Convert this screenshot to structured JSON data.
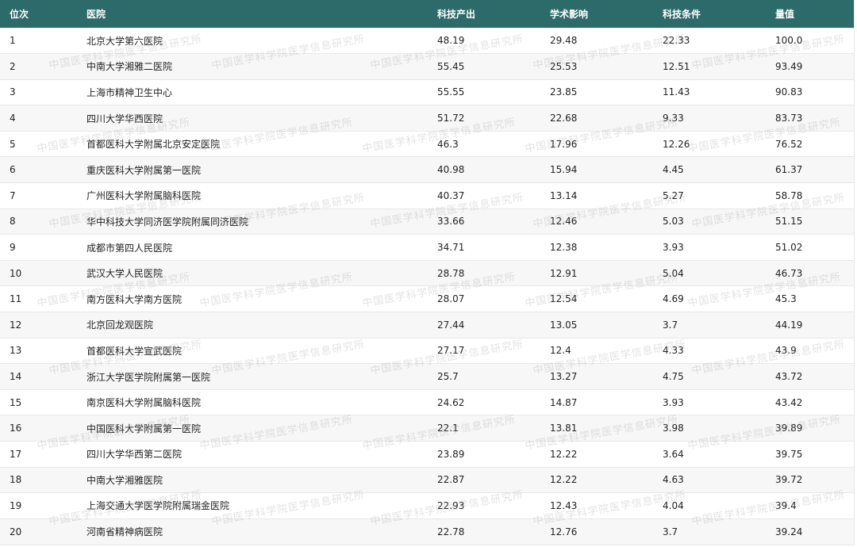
{
  "table": {
    "headers": {
      "rank": "位次",
      "hospital": "医院",
      "output": "科技产出",
      "academic": "学术影响",
      "condition": "科技条件",
      "score": "量值"
    },
    "rows": [
      {
        "rank": "1",
        "hospital": "北京大学第六医院",
        "output": "48.19",
        "academic": "29.48",
        "condition": "22.33",
        "score": "100.0"
      },
      {
        "rank": "2",
        "hospital": "中南大学湘雅二医院",
        "output": "55.45",
        "academic": "25.53",
        "condition": "12.51",
        "score": "93.49"
      },
      {
        "rank": "3",
        "hospital": "上海市精神卫生中心",
        "output": "55.55",
        "academic": "23.85",
        "condition": "11.43",
        "score": "90.83"
      },
      {
        "rank": "4",
        "hospital": "四川大学华西医院",
        "output": "51.72",
        "academic": "22.68",
        "condition": "9.33",
        "score": "83.73"
      },
      {
        "rank": "5",
        "hospital": "首都医科大学附属北京安定医院",
        "output": "46.3",
        "academic": "17.96",
        "condition": "12.26",
        "score": "76.52"
      },
      {
        "rank": "6",
        "hospital": "重庆医科大学附属第一医院",
        "output": "40.98",
        "academic": "15.94",
        "condition": "4.45",
        "score": "61.37"
      },
      {
        "rank": "7",
        "hospital": "广州医科大学附属脑科医院",
        "output": "40.37",
        "academic": "13.14",
        "condition": "5.27",
        "score": "58.78"
      },
      {
        "rank": "8",
        "hospital": "华中科技大学同济医学院附属同济医院",
        "output": "33.66",
        "academic": "12.46",
        "condition": "5.03",
        "score": "51.15"
      },
      {
        "rank": "9",
        "hospital": "成都市第四人民医院",
        "output": "34.71",
        "academic": "12.38",
        "condition": "3.93",
        "score": "51.02"
      },
      {
        "rank": "10",
        "hospital": "武汉大学人民医院",
        "output": "28.78",
        "academic": "12.91",
        "condition": "5.04",
        "score": "46.73"
      },
      {
        "rank": "11",
        "hospital": "南方医科大学南方医院",
        "output": "28.07",
        "academic": "12.54",
        "condition": "4.69",
        "score": "45.3"
      },
      {
        "rank": "12",
        "hospital": "北京回龙观医院",
        "output": "27.44",
        "academic": "13.05",
        "condition": "3.7",
        "score": "44.19"
      },
      {
        "rank": "13",
        "hospital": "首都医科大学宣武医院",
        "output": "27.17",
        "academic": "12.4",
        "condition": "4.33",
        "score": "43.9"
      },
      {
        "rank": "14",
        "hospital": "浙江大学医学院附属第一医院",
        "output": "25.7",
        "academic": "13.27",
        "condition": "4.75",
        "score": "43.72"
      },
      {
        "rank": "15",
        "hospital": "南京医科大学附属脑科医院",
        "output": "24.62",
        "academic": "14.87",
        "condition": "3.93",
        "score": "43.42"
      },
      {
        "rank": "16",
        "hospital": "中国医科大学附属第一医院",
        "output": "22.1",
        "academic": "13.81",
        "condition": "3.98",
        "score": "39.89"
      },
      {
        "rank": "17",
        "hospital": "四川大学华西第二医院",
        "output": "23.89",
        "academic": "12.22",
        "condition": "3.64",
        "score": "39.75"
      },
      {
        "rank": "18",
        "hospital": "中南大学湘雅医院",
        "output": "22.87",
        "academic": "12.22",
        "condition": "4.63",
        "score": "39.72"
      },
      {
        "rank": "19",
        "hospital": "上海交通大学医学院附属瑞金医院",
        "output": "22.93",
        "academic": "12.43",
        "condition": "4.04",
        "score": "39.4"
      },
      {
        "rank": "20",
        "hospital": "河南省精神病医院",
        "output": "22.78",
        "academic": "12.76",
        "condition": "3.7",
        "score": "39.24"
      }
    ]
  },
  "watermark": {
    "text": "中国医学科学院医学信息研究所"
  },
  "colors": {
    "header_bg": "#2d6a6a",
    "header_text": "#ffffff",
    "row_alt_bg": "#f7f7f7"
  }
}
